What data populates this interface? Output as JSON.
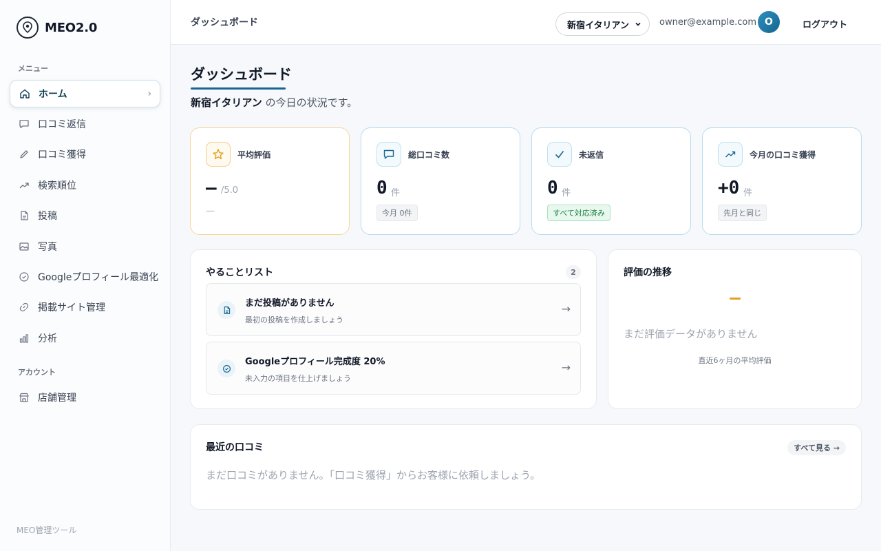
{
  "app": {
    "name": "MEO2.0",
    "footer": "MEO管理ツール"
  },
  "sidebar": {
    "menu_label": "メニュー",
    "account_label": "アカウント",
    "items": [
      {
        "label": "ホーム",
        "icon": "home-icon"
      },
      {
        "label": "口コミ返信",
        "icon": "chat-bubble-icon"
      },
      {
        "label": "口コミ獲得",
        "icon": "pencil-icon"
      },
      {
        "label": "検索順位",
        "icon": "trend-up-icon"
      },
      {
        "label": "投稿",
        "icon": "document-icon"
      },
      {
        "label": "写真",
        "icon": "image-icon"
      },
      {
        "label": "Googleプロフィール最適化",
        "icon": "check-circle-icon"
      },
      {
        "label": "掲載サイト管理",
        "icon": "link-icon"
      },
      {
        "label": "分析",
        "icon": "bar-chart-icon"
      }
    ],
    "account_items": [
      {
        "label": "店舗管理",
        "icon": "store-icon"
      }
    ]
  },
  "header": {
    "title": "ダッシュボード",
    "store": "新宿イタリアン",
    "email": "owner@example.com",
    "avatar_initial": "O",
    "logout": "ログアウト"
  },
  "page": {
    "title": "ダッシュボード",
    "store_name": "新宿イタリアン",
    "subtitle_suffix": " の今日の状況です。"
  },
  "stats": {
    "rating": {
      "label": "平均評価",
      "value": "—",
      "unit": "/5.0",
      "note": "—"
    },
    "total_reviews": {
      "label": "総口コミ数",
      "value": "0",
      "unit": "件",
      "chip": "今月 0件"
    },
    "unreplied": {
      "label": "未返信",
      "value": "0",
      "unit": "件",
      "chip": "すべて対応済み"
    },
    "monthly": {
      "label": "今月の口コミ獲得",
      "value": "+0",
      "unit": "件",
      "chip": "先月と同じ"
    }
  },
  "todo": {
    "title": "やることリスト",
    "count": "2",
    "items": [
      {
        "title": "まだ投稿がありません",
        "desc": "最初の投稿を作成しましょう",
        "icon": "document-icon"
      },
      {
        "title": "Googleプロフィール完成度 20%",
        "desc": "未入力の項目を仕上げましょう",
        "icon": "check-circle-icon"
      }
    ]
  },
  "rating_trend": {
    "title": "評価の推移",
    "empty": "まだ評価データがありません",
    "caption": "直近6ヶ月の平均評価"
  },
  "recent_reviews": {
    "title": "最近の口コミ",
    "see_all": "すべて見る →",
    "empty": "まだ口コミがありません。「口コミ獲得」からお客様に依頼しましょう。"
  },
  "colors": {
    "accent": "#16668f",
    "amber": "#e99b22",
    "success": "#17803d"
  }
}
